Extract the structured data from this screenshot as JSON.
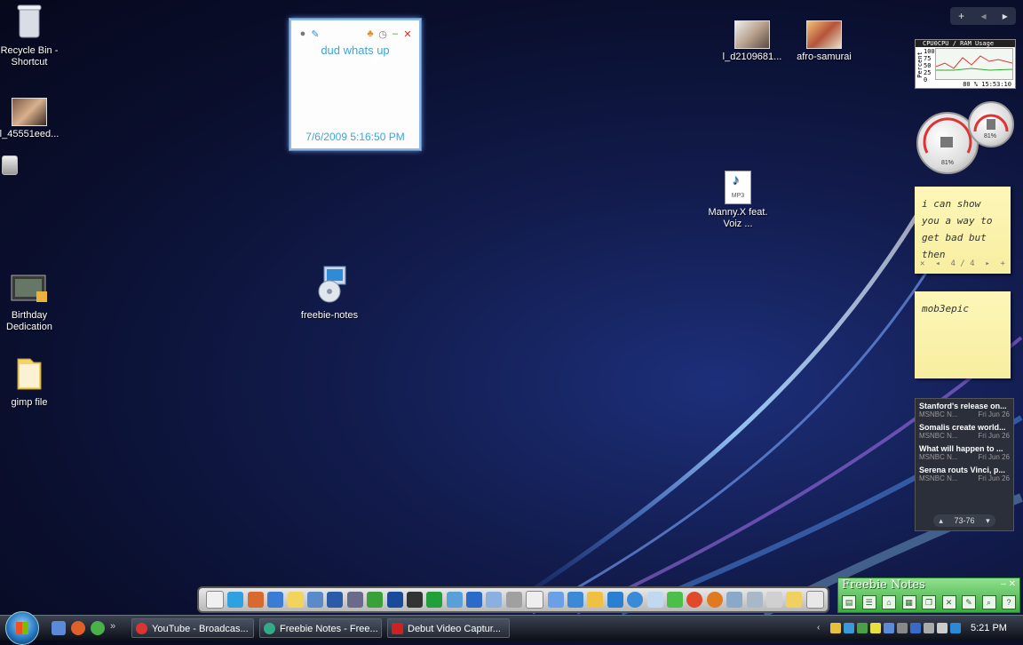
{
  "desktop_icons": [
    {
      "label": "Recycle Bin - Shortcut",
      "icon": "recycle-bin-icon"
    },
    {
      "label": "l_45551eed...",
      "icon": "photo-icon"
    },
    {
      "label": "Birthday Dedication",
      "icon": "video-icon"
    },
    {
      "label": "gimp file",
      "icon": "folder-icon"
    },
    {
      "label": "freebie-notes",
      "icon": "installer-icon"
    },
    {
      "label": "l_d2109681...",
      "icon": "photo-icon"
    },
    {
      "label": "afro-samurai",
      "icon": "photo-icon"
    },
    {
      "label": "Manny.X feat. Voiz ...",
      "icon": "mp3-icon",
      "badge": "MP3"
    }
  ],
  "note_widget": {
    "text": "dud whats up",
    "date": "7/6/2009 5:16:50 PM"
  },
  "cpu_meter": {
    "header": "CPU0CPU / RAM Usage",
    "axis_label": "Percent",
    "y_ticks": [
      "100",
      "75",
      "50",
      "25",
      "0"
    ],
    "footer": "80 % 15:53:10"
  },
  "gauges": {
    "cpu_pct": "81%",
    "ram_pct": "81%"
  },
  "sticky_notes": [
    {
      "text": "i can show you a way to get bad but then",
      "pager": "4 / 4"
    },
    {
      "text": "mob3epic"
    }
  ],
  "news_feed": {
    "items": [
      {
        "title": "Stanford's release on...",
        "source": "MSNBC N...",
        "date": "Fri Jun 26"
      },
      {
        "title": "Somalis create world...",
        "source": "MSNBC N...",
        "date": "Fri Jun 26"
      },
      {
        "title": "What will happen to ...",
        "source": "MSNBC N...",
        "date": "Fri Jun 26"
      },
      {
        "title": "Serena routs Vinci, p...",
        "source": "MSNBC N...",
        "date": "Fri Jun 26"
      }
    ],
    "pager": "73-76"
  },
  "freebie_bar": {
    "title": "Freebie Notes"
  },
  "taskbar": {
    "buttons": [
      {
        "label": "YouTube - Broadcas...",
        "color": "#d33"
      },
      {
        "label": "Freebie Notes - Free...",
        "color": "#3a8"
      },
      {
        "label": "Debut Video Captur...",
        "color": "#c22"
      }
    ],
    "quick_more": "»",
    "clock": "5:21 PM"
  }
}
